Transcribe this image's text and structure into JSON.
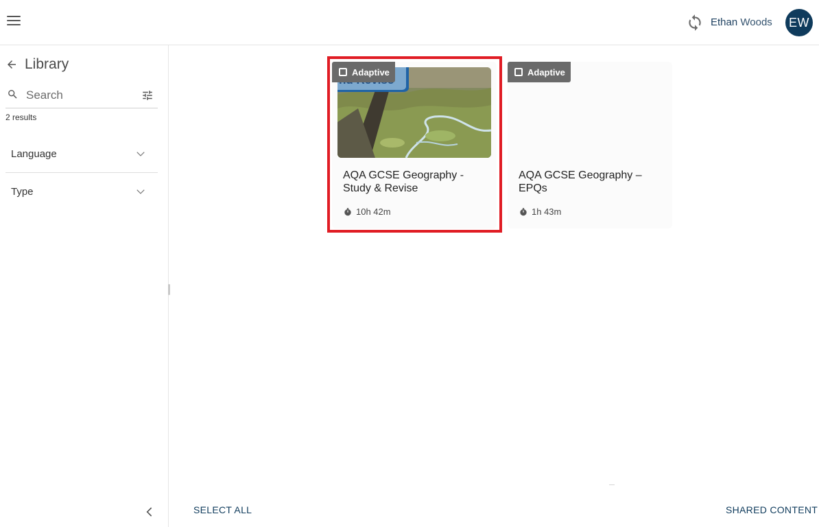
{
  "header": {
    "menu_icon": "hamburger-icon",
    "sync_icon": "sync-icon",
    "user_first_name": "Ethan",
    "user_last_name": "Woods",
    "avatar_initials": "EW",
    "brand_color": "#0f3b5c"
  },
  "sidebar": {
    "back_icon": "arrow-left-icon",
    "title": "Library",
    "search": {
      "placeholder": "Search",
      "value": ""
    },
    "results_text": "2 results",
    "filters": [
      {
        "label": "Language",
        "icon": "chevron-down-icon"
      },
      {
        "label": "Type",
        "icon": "chevron-down-icon"
      }
    ],
    "collapse_icon": "chevron-left-icon"
  },
  "cards": [
    {
      "badge": "Adaptive",
      "title": "AQA GCSE Geography - Study & Revise",
      "duration": "10h 42m",
      "thumbnail_overlay_text": "nd Revise",
      "selected": true
    },
    {
      "badge": "Adaptive",
      "title": "AQA GCSE Geography – EPQs",
      "duration": "1h 43m",
      "selected": false
    }
  ],
  "footer": {
    "select_all": "SELECT ALL",
    "shared_content": "SHARED CONTENT"
  },
  "highlight_color": "#e01c24"
}
